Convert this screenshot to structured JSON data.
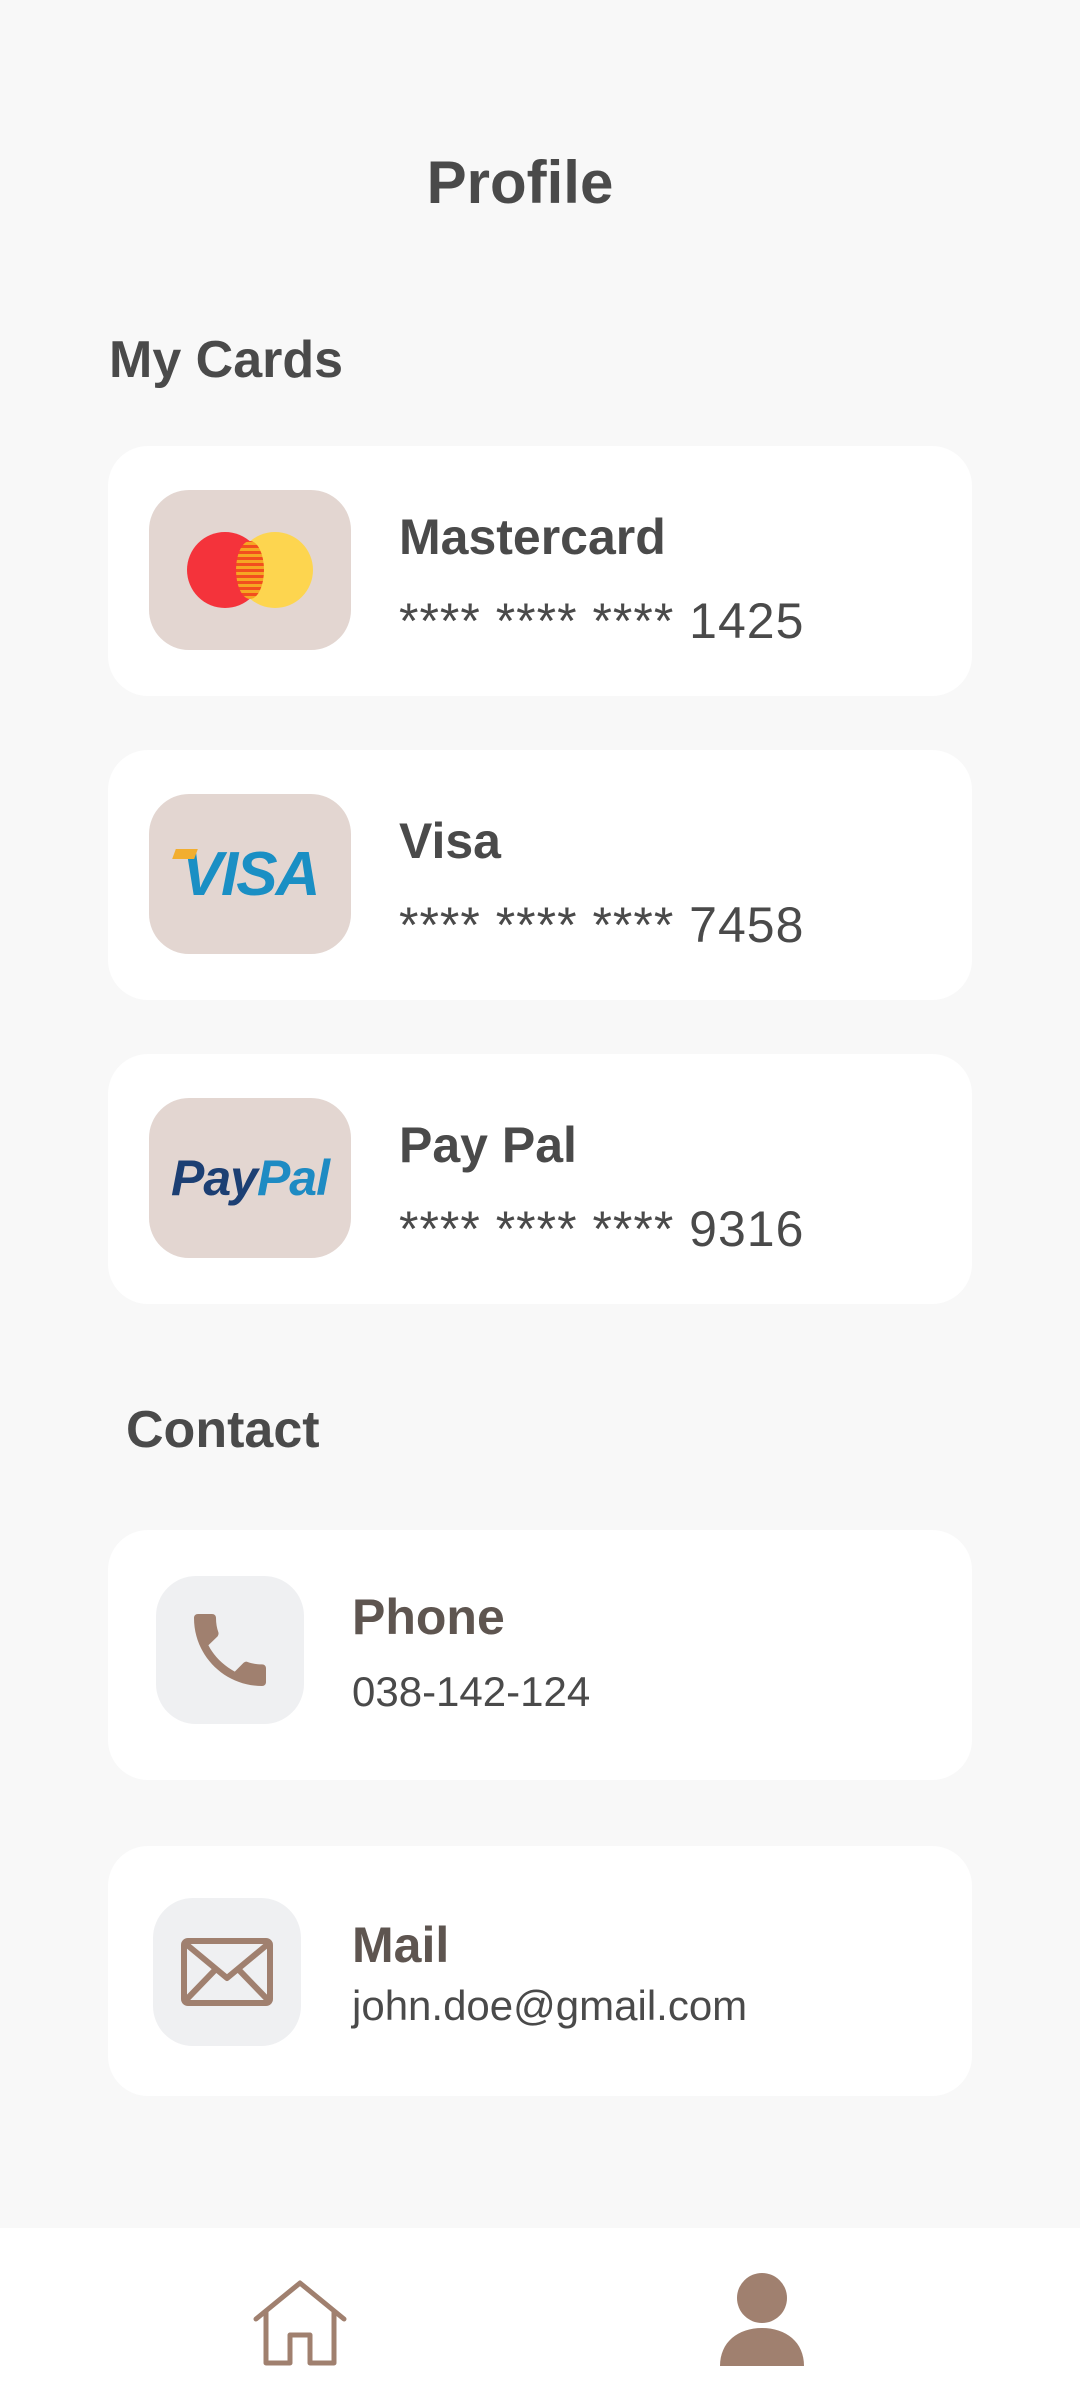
{
  "header": {
    "title": "Profile"
  },
  "cards_section": {
    "title": "My Cards",
    "cards": [
      {
        "name": "Mastercard",
        "number": "**** **** **** 1425",
        "logo": "mastercard-logo"
      },
      {
        "name": "Visa",
        "number": "**** **** **** 7458",
        "logo": "visa-logo",
        "logo_text": "VISA"
      },
      {
        "name": "Pay Pal",
        "number": "**** **** **** 9316",
        "logo": "paypal-logo",
        "logo_text": "PayPal"
      }
    ]
  },
  "contact_section": {
    "title": "Contact",
    "items": [
      {
        "label": "Phone",
        "value": "038-142-124",
        "icon": "phone-icon"
      },
      {
        "label": "Mail",
        "value": "john.doe@gmail.com",
        "icon": "mail-icon"
      }
    ]
  },
  "bottom_nav": {
    "items": [
      {
        "icon": "home-icon"
      },
      {
        "icon": "profile-icon",
        "active": true
      }
    ]
  },
  "colors": {
    "background": "#f8f8f8",
    "card": "#ffffff",
    "logo_tile": "#e3d6d1",
    "icon_tile": "#eff0f2",
    "accent_brown": "#a0806f",
    "text": "#4a4a4a"
  }
}
